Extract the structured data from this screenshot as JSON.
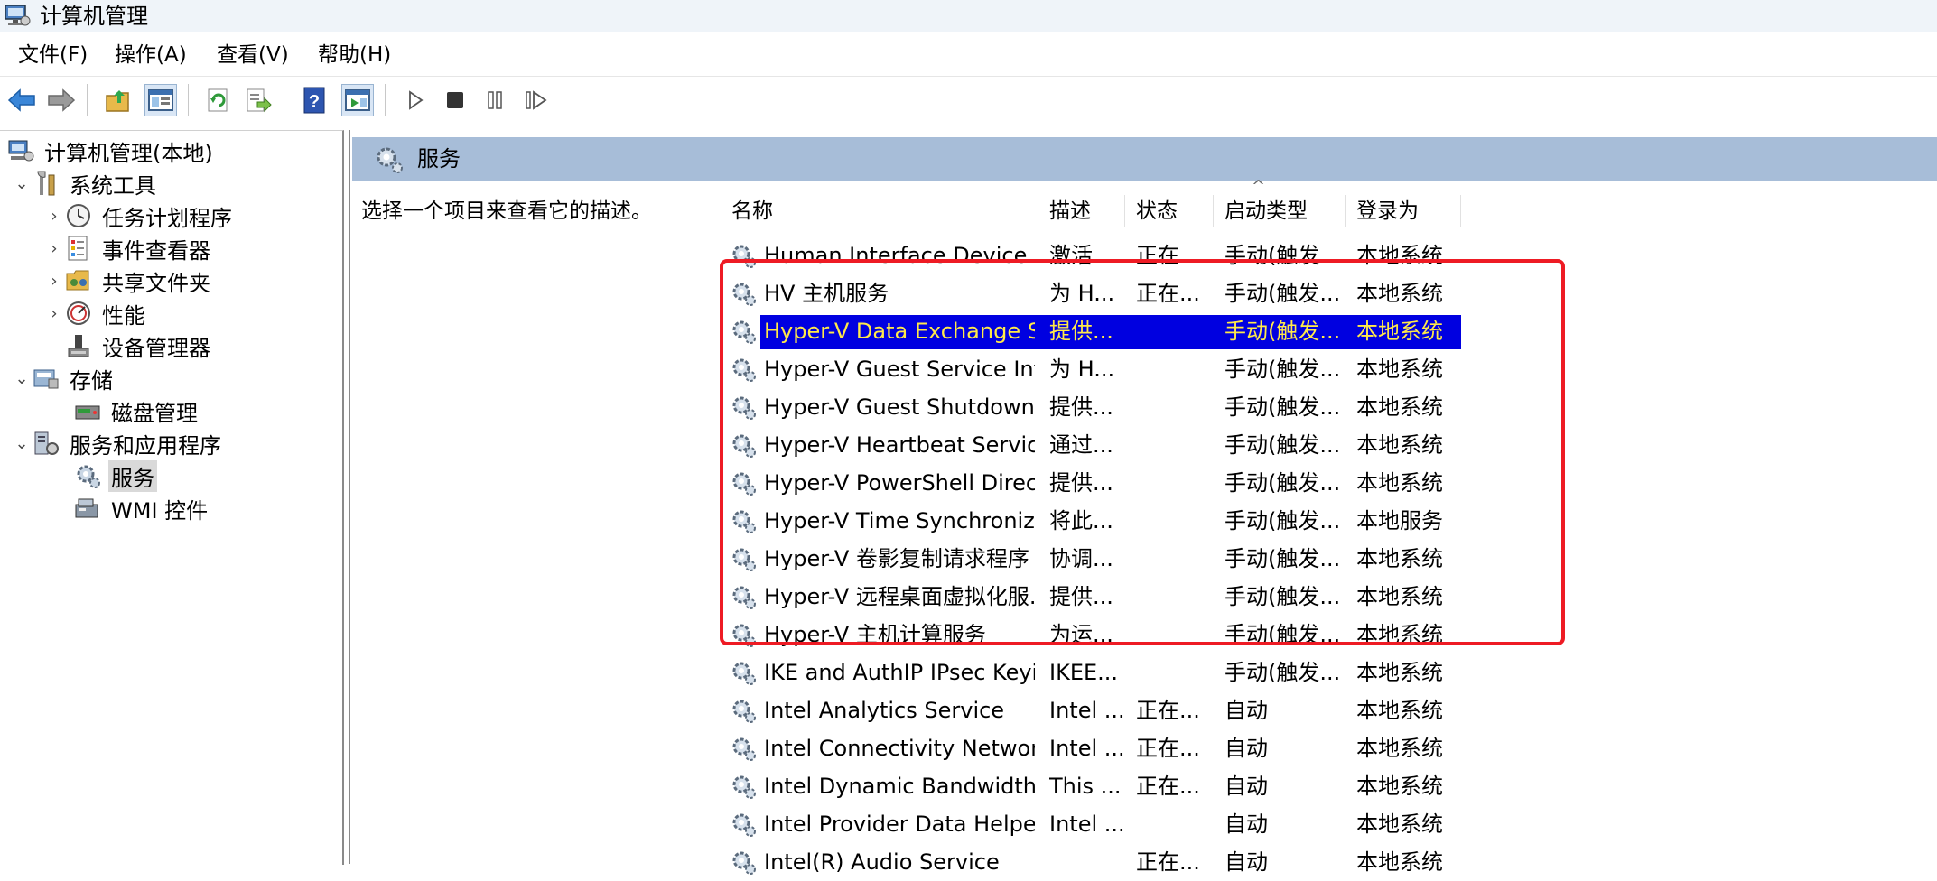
{
  "window": {
    "title": "计算机管理"
  },
  "menu": [
    "文件(F)",
    "操作(A)",
    "查看(V)",
    "帮助(H)"
  ],
  "tree": {
    "root": "计算机管理(本地)",
    "nodes": [
      {
        "label": "系统工具",
        "expanded": true
      },
      {
        "label": "任务计划程序"
      },
      {
        "label": "事件查看器"
      },
      {
        "label": "共享文件夹"
      },
      {
        "label": "性能"
      },
      {
        "label": "设备管理器"
      },
      {
        "label": "存储",
        "expanded": true
      },
      {
        "label": "磁盘管理"
      },
      {
        "label": "服务和应用程序",
        "expanded": true
      },
      {
        "label": "服务",
        "selected": true
      },
      {
        "label": "WMI 控件"
      }
    ]
  },
  "services_panel": {
    "title": "服务",
    "description_prompt": "选择一个项目来查看它的描述。",
    "sort_indicator": "^",
    "columns": [
      "名称",
      "描述",
      "状态",
      "启动类型",
      "登录为"
    ],
    "rows": [
      [
        "Human Interface Device S...",
        "激活...",
        "正在...",
        "手动(触发...",
        "本地系统"
      ],
      [
        "HV 主机服务",
        "为 H...",
        "正在...",
        "手动(触发...",
        "本地系统"
      ],
      [
        "Hyper-V Data Exchange Se...",
        "提供...",
        "",
        "手动(触发...",
        "本地系统"
      ],
      [
        "Hyper-V Guest Service Int...",
        "为 H...",
        "",
        "手动(触发...",
        "本地系统"
      ],
      [
        "Hyper-V Guest Shutdown ...",
        "提供...",
        "",
        "手动(触发...",
        "本地系统"
      ],
      [
        "Hyper-V Heartbeat Service",
        "通过...",
        "",
        "手动(触发...",
        "本地系统"
      ],
      [
        "Hyper-V PowerShell Direct...",
        "提供...",
        "",
        "手动(触发...",
        "本地系统"
      ],
      [
        "Hyper-V Time Synchroniza...",
        "将此...",
        "",
        "手动(触发...",
        "本地服务"
      ],
      [
        "Hyper-V 卷影复制请求程序",
        "协调...",
        "",
        "手动(触发...",
        "本地系统"
      ],
      [
        "Hyper-V 远程桌面虚拟化服...",
        "提供...",
        "",
        "手动(触发...",
        "本地系统"
      ],
      [
        "Hyper-V 主机计算服务",
        "为运...",
        "",
        "手动(触发...",
        "本地系统"
      ],
      [
        "IKE and AuthIP IPsec Keyin...",
        "IKEE...",
        "",
        "手动(触发...",
        "本地系统"
      ],
      [
        "Intel Analytics Service",
        "Intel ...",
        "正在...",
        "自动",
        "本地系统"
      ],
      [
        "Intel Connectivity Network...",
        "Intel ...",
        "正在...",
        "自动",
        "本地系统"
      ],
      [
        "Intel Dynamic Bandwidth ...",
        "This ...",
        "正在...",
        "自动",
        "本地系统"
      ],
      [
        "Intel Provider Data Helper ...",
        "Intel ...",
        "",
        "自动",
        "本地系统"
      ],
      [
        "Intel(R) Audio Service",
        "",
        "正在...",
        "自动",
        "本地系统"
      ]
    ],
    "selected_row_index": 2,
    "selection_color": "#0000e0",
    "selection_text_color": "#ffe94a",
    "highlight_color": "#ee1b24"
  },
  "toolbar_icons": [
    "back-icon",
    "forward-icon",
    "up-folder-icon",
    "show-hide-tree-icon",
    "refresh-icon",
    "export-list-icon",
    "help-icon",
    "properties-icon",
    "play-icon",
    "stop-icon",
    "pause-icon",
    "resume-icon"
  ]
}
